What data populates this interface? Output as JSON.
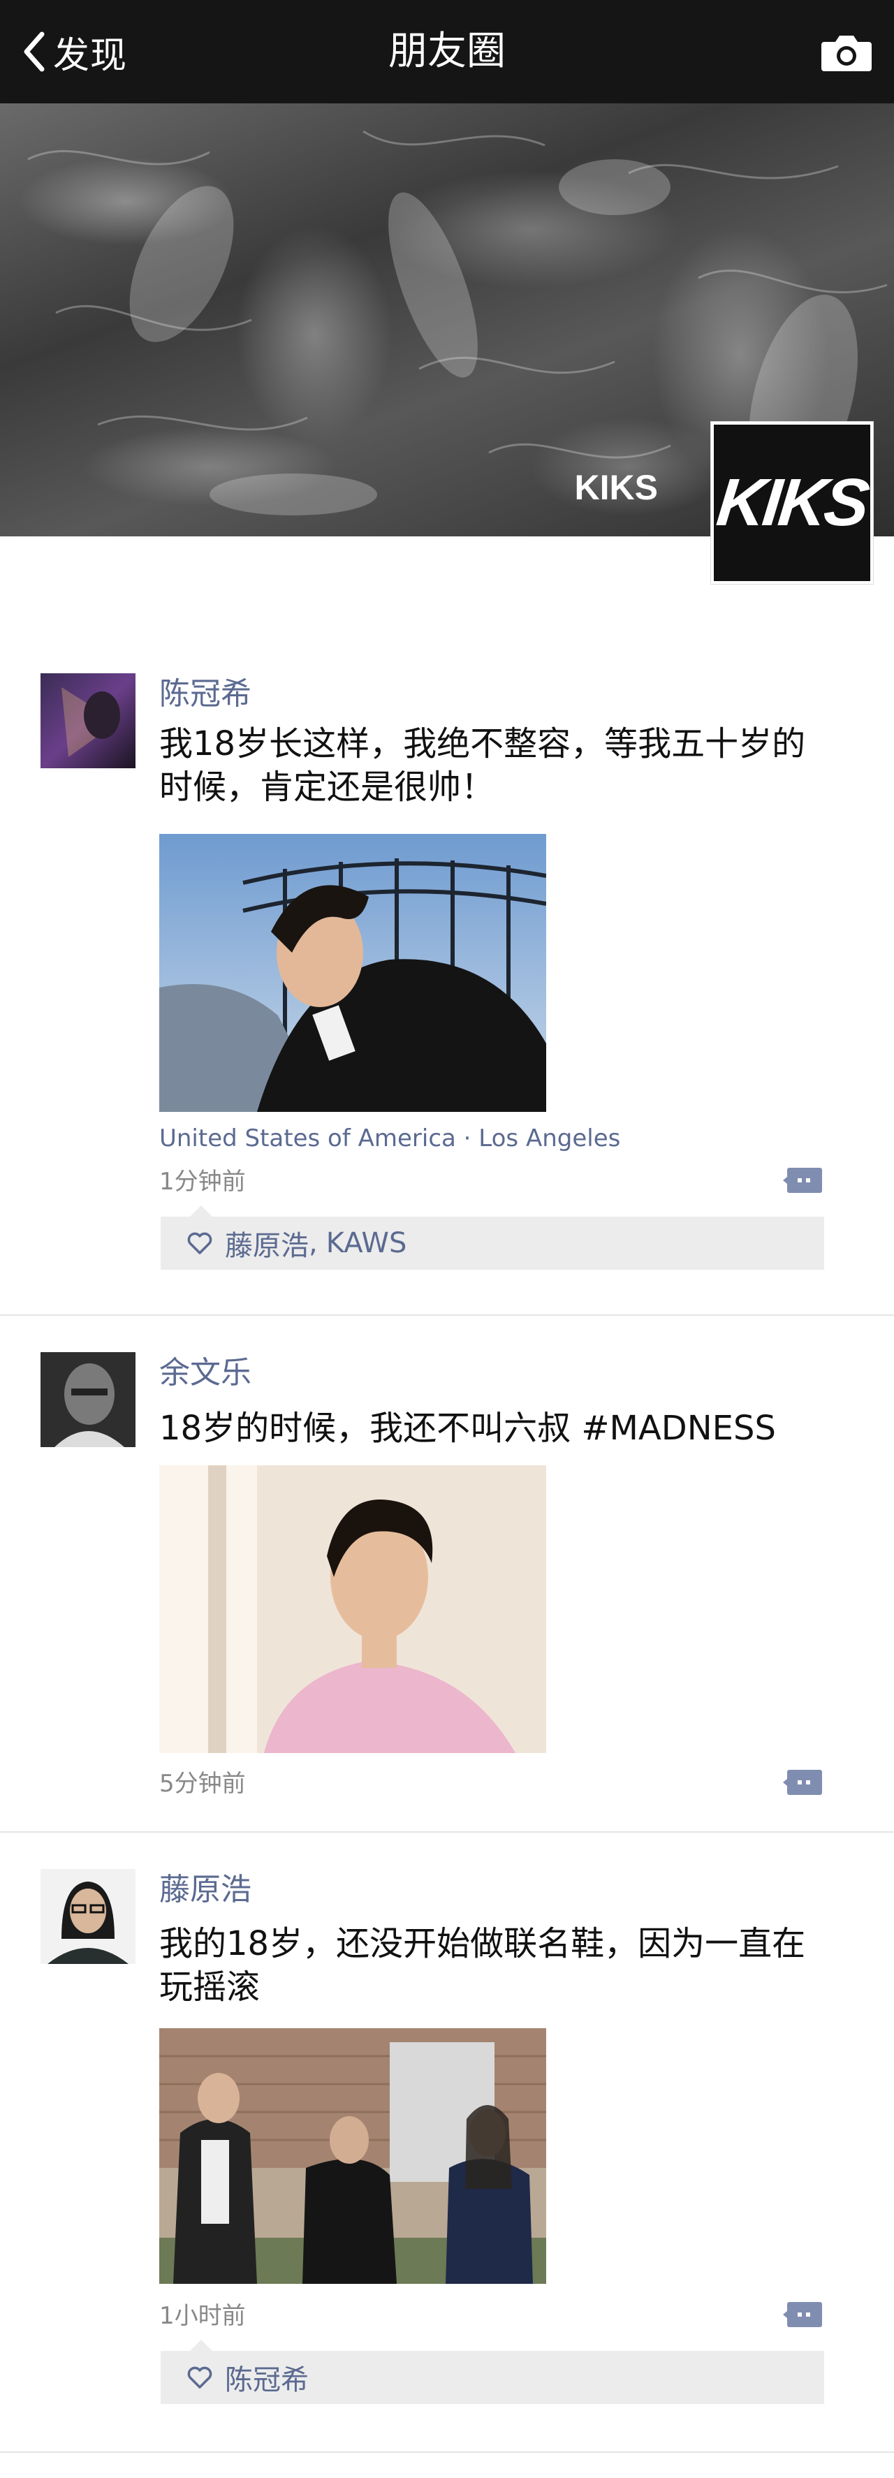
{
  "nav": {
    "back_label": "发现",
    "title": "朋友圈"
  },
  "cover": {
    "name": "KIKS",
    "avatar_text": "KIKS"
  },
  "posts": [
    {
      "author": "陈冠希",
      "text": "我18岁长这样，我绝不整容，等我五十岁的时候，肯定还是很帅！",
      "location": "United States of America · Los Angeles",
      "time": "1分钟前",
      "likes": [
        "藤原浩",
        "KAWS"
      ]
    },
    {
      "author": "余文乐",
      "text": "18岁的时候，我还不叫六叔 #MADNESS",
      "time": "5分钟前"
    },
    {
      "author": "藤原浩",
      "text": "我的18岁，还没开始做联名鞋，因为一直在玩摇滚",
      "time": "1小时前",
      "likes": [
        "陈冠希"
      ]
    }
  ],
  "colors": {
    "nav_bg": "#151515",
    "name_link": "#5b6a91",
    "likes_bg": "#ececec",
    "divider": "#e5e5e5"
  },
  "icons": {
    "back": "chevron-left-icon",
    "camera": "camera-icon",
    "comment": "comment-dots-icon",
    "like": "heart-outline-icon"
  }
}
